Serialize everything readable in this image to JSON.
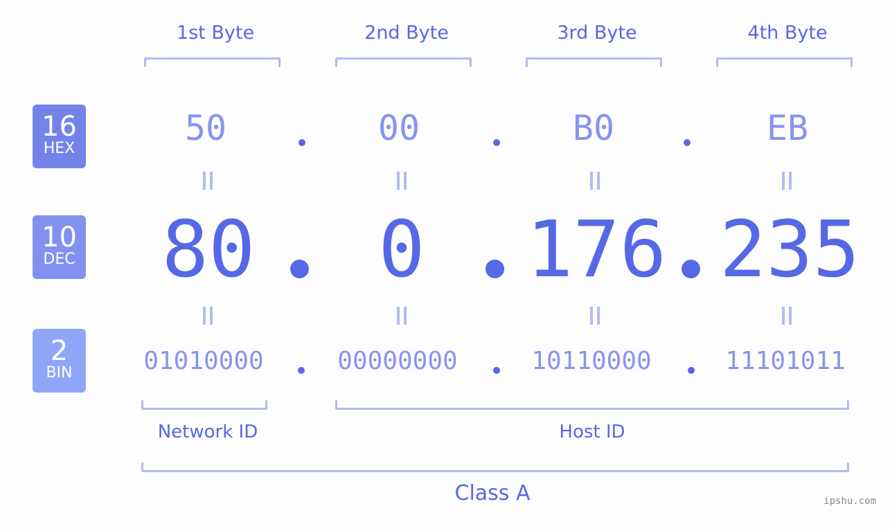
{
  "headers": [
    "1st Byte",
    "2nd Byte",
    "3rd Byte",
    "4th Byte"
  ],
  "badges": {
    "hex": {
      "num": "16",
      "label": "HEX",
      "color": "#7483ea"
    },
    "dec": {
      "num": "10",
      "label": "DEC",
      "color": "#8291f0"
    },
    "bin": {
      "num": "2",
      "label": "BIN",
      "color": "#8fa6f8"
    }
  },
  "hex": [
    "50",
    "00",
    "B0",
    "EB"
  ],
  "dec": [
    "80",
    "0",
    "176",
    "235"
  ],
  "bin": [
    "01010000",
    "00000000",
    "10110000",
    "11101011"
  ],
  "labels": {
    "network_id": "Network ID",
    "host_id": "Host ID",
    "class": "Class A"
  },
  "watermark": "ipshu.com"
}
